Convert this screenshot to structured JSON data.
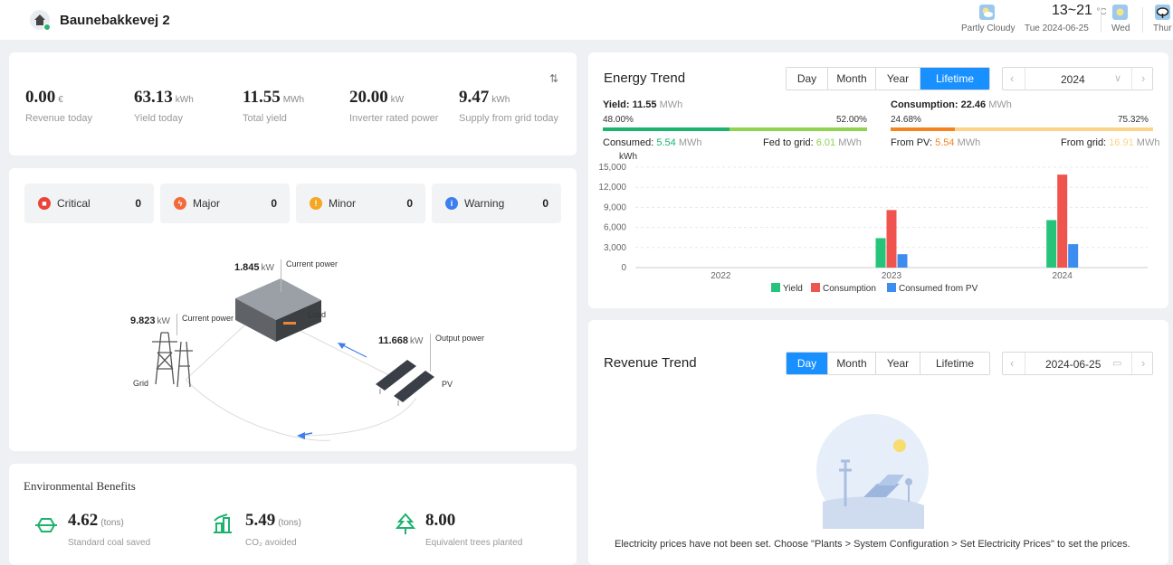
{
  "header": {
    "plant_name": "Baunebakkevej 2",
    "weather": {
      "condition": "Partly Cloudy",
      "temp": "13~21",
      "temp_unit": "°C",
      "date": "Tue 2024-06-25",
      "day2": "Wed",
      "day3": "Thur"
    }
  },
  "kpis": [
    {
      "value": "0.00",
      "unit": "€",
      "label": "Revenue today"
    },
    {
      "value": "63.13",
      "unit": "kWh",
      "label": "Yield today"
    },
    {
      "value": "11.55",
      "unit": "MWh",
      "label": "Total yield"
    },
    {
      "value": "20.00",
      "unit": "kW",
      "label": "Inverter rated power"
    },
    {
      "value": "9.47",
      "unit": "kWh",
      "label": "Supply from grid today"
    }
  ],
  "alarms": [
    {
      "name": "Critical",
      "count": "0",
      "color": "#e8453c",
      "glyph": "!"
    },
    {
      "name": "Major",
      "count": "0",
      "color": "#f26b3a",
      "glyph": "ϟ"
    },
    {
      "name": "Minor",
      "count": "0",
      "color": "#f5a623",
      "glyph": "!"
    },
    {
      "name": "Warning",
      "count": "0",
      "color": "#3d7ef0",
      "glyph": "i"
    }
  ],
  "flow": {
    "load_power": "1.845",
    "load_unit": "kW",
    "load_label": "Current power",
    "load_node": "Load",
    "grid_power": "9.823",
    "grid_unit": "kW",
    "grid_label": "Current power",
    "grid_node": "Grid",
    "pv_power": "11.668",
    "pv_unit": "kW",
    "pv_label": "Output power",
    "pv_node": "PV"
  },
  "environment": {
    "title": "Environmental Benefits",
    "items": [
      {
        "value": "4.62",
        "unit": "(tons)",
        "label": "Standard coal saved",
        "icon": "coal-icon"
      },
      {
        "value": "5.49",
        "unit": "(tons)",
        "label": "CO₂ avoided",
        "icon": "co2-icon"
      },
      {
        "value": "8.00",
        "unit": "",
        "label": "Equivalent trees planted",
        "icon": "tree-icon"
      }
    ]
  },
  "energy_trend": {
    "title": "Energy Trend",
    "tabs": [
      "Day",
      "Month",
      "Year",
      "Lifetime"
    ],
    "active_tab": "Lifetime",
    "picker_value": "2024",
    "yield_label": "Yield:",
    "yield_value": "11.55",
    "yield_unit": "MWh",
    "yield_pct_left": "48.00%",
    "yield_pct_right": "52.00%",
    "consumed_label": "Consumed:",
    "consumed_value": "5.54",
    "consumed_unit": "MWh",
    "fed_label": "Fed to grid:",
    "fed_value": "6.01",
    "fed_unit": "MWh",
    "consumption_label": "Consumption:",
    "consumption_value": "22.46",
    "consumption_unit": "MWh",
    "cons_pct_left": "24.68%",
    "cons_pct_right": "75.32%",
    "from_pv_label": "From PV:",
    "from_pv_value": "5.54",
    "from_pv_unit": "MWh",
    "from_grid_label": "From grid:",
    "from_grid_value": "16.91",
    "from_grid_unit": "MWh",
    "colors": {
      "green": "#1cb36f",
      "light_green": "#8fd44f",
      "orange": "#f5841f",
      "light_orange": "#fbd38a"
    }
  },
  "chart_data": {
    "type": "bar",
    "categories": [
      "2022",
      "2023",
      "2024"
    ],
    "ylabel": "kWh",
    "yticks": [
      "15,000",
      "12,000",
      "9,000",
      "6,000",
      "3,000",
      "0"
    ],
    "ylim": [
      0,
      15000
    ],
    "series": [
      {
        "name": "Yield",
        "color": "#26c47a",
        "values": [
          0,
          4400,
          7100
        ]
      },
      {
        "name": "Consumption",
        "color": "#f0544f",
        "values": [
          0,
          8600,
          13900
        ]
      },
      {
        "name": "Consumed from PV",
        "color": "#3d8cf0",
        "values": [
          0,
          2000,
          3500
        ]
      }
    ],
    "legend": "bottom"
  },
  "revenue_trend": {
    "title": "Revenue Trend",
    "tabs": [
      "Day",
      "Month",
      "Year",
      "Lifetime"
    ],
    "active_tab": "Day",
    "picker_value": "2024-06-25",
    "empty_message": "Electricity prices have not been set. Choose \"Plants > System Configuration > Set Electricity Prices\" to set the prices."
  }
}
